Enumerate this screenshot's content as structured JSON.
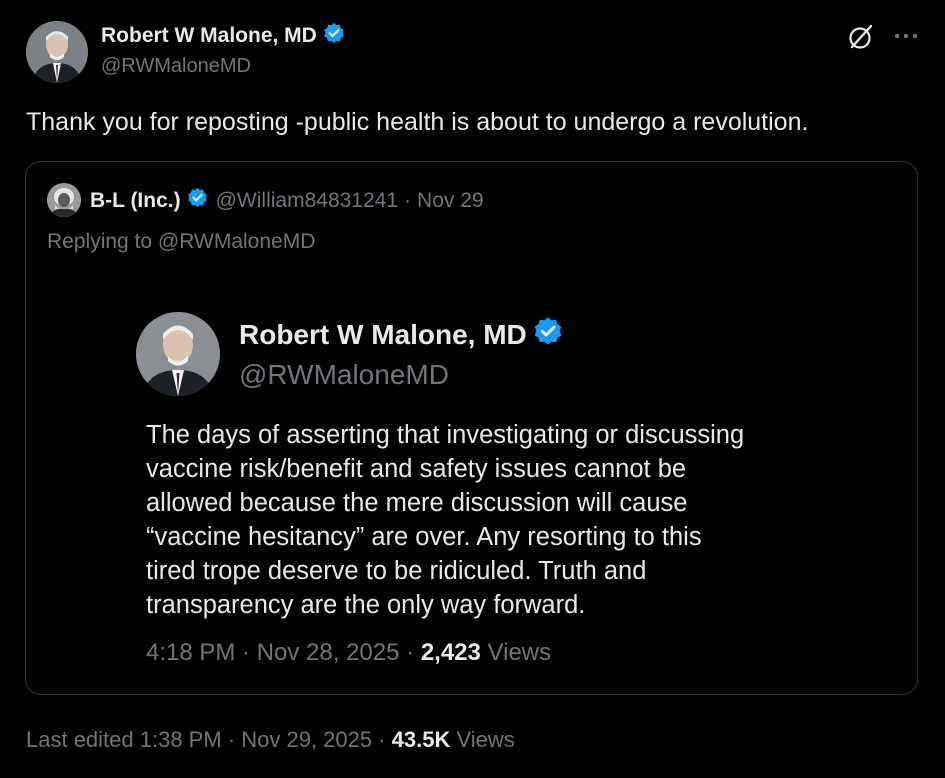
{
  "post": {
    "author_name": "Robert W Malone, MD",
    "author_handle": "@RWMaloneMD",
    "text": "Thank you for reposting -public health is about to undergo a revolution."
  },
  "quote": {
    "author_name": "B-L (Inc.)",
    "author_handle": "@William84831241",
    "separator": "·",
    "date": "Nov 29",
    "replying_to": "Replying to @RWMaloneMD"
  },
  "screenshot": {
    "author_name": "Robert W Malone, MD",
    "author_handle": "@RWMaloneMD",
    "lines": [
      "The days of asserting that investigating or discussing",
      "vaccine risk/benefit and safety issues cannot be",
      "allowed because the mere discussion will cause",
      "“vaccine hesitancy” are over.  Any resorting to this",
      "tired trope deserve to be ridiculed.  Truth and",
      "transparency are the only way forward."
    ],
    "time": "4:18 PM · Nov 28, 2025 ·",
    "views_count": "2,423",
    "views_label": "Views"
  },
  "footer": {
    "edited": "Last edited 1:38 PM · Nov 29, 2025 ·",
    "views_count": "43.5K",
    "views_label": "Views"
  },
  "icons": {
    "verified": "verified-badge-icon",
    "grok": "grok-icon",
    "more": "more-icon"
  },
  "colors": {
    "background": "#000000",
    "text": "#e7e9ea",
    "muted": "#71767b",
    "verified": "#1d9bf0",
    "border": "#2f3336"
  }
}
